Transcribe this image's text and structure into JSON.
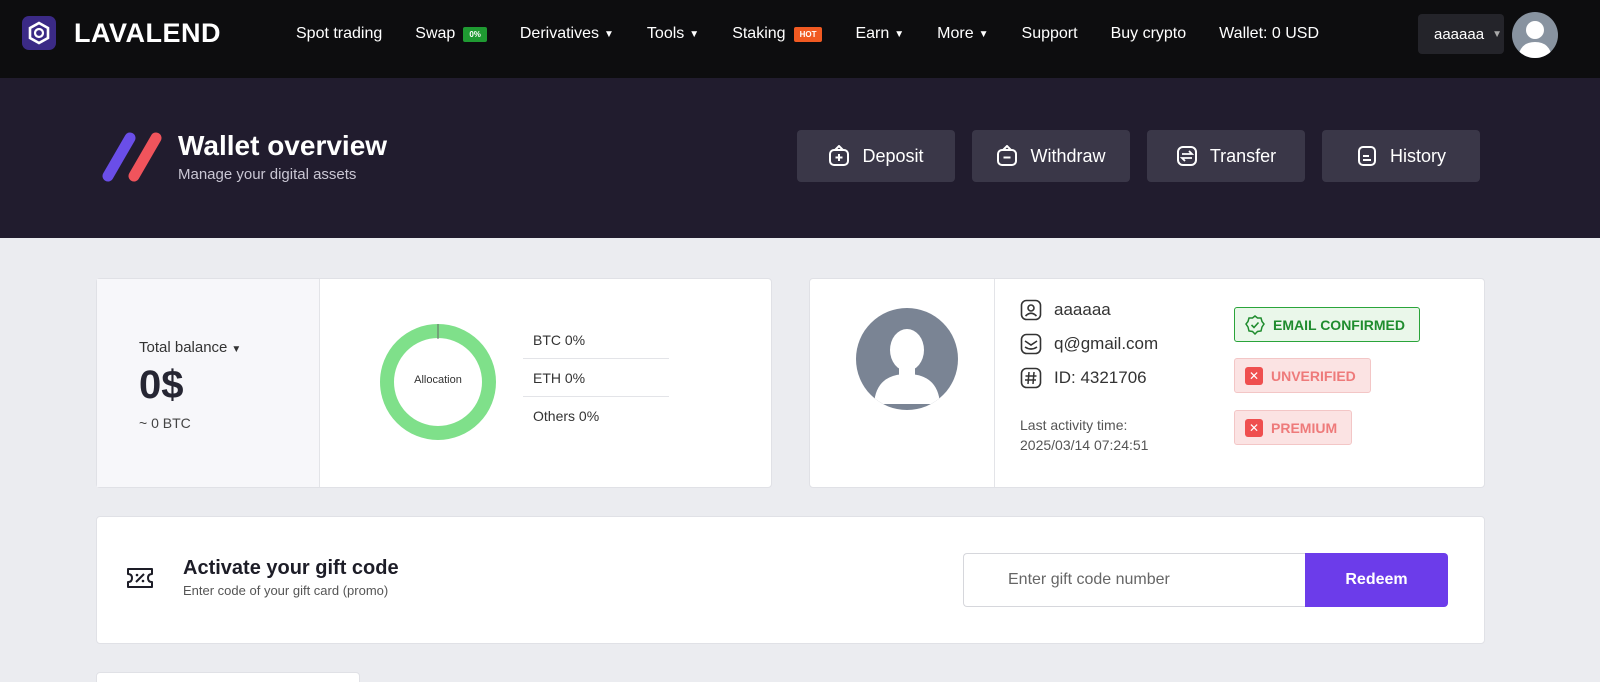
{
  "brand": {
    "name": "LAVALEND",
    "logo_icon": "hexagon-logo-icon"
  },
  "nav": {
    "items": [
      {
        "label": "Spot trading"
      },
      {
        "label": "Swap",
        "badge": "0%",
        "badge_color": "#1f9a32"
      },
      {
        "label": "Derivatives",
        "dropdown": true
      },
      {
        "label": "Tools",
        "dropdown": true
      },
      {
        "label": "Staking",
        "badge": "HOT",
        "badge_color": "#f15a22"
      },
      {
        "label": "Earn",
        "dropdown": true
      },
      {
        "label": "More",
        "dropdown": true
      },
      {
        "label": "Support"
      },
      {
        "label": "Buy crypto"
      },
      {
        "label": "Wallet: 0 USD"
      }
    ],
    "username": "aaaaaa"
  },
  "hero": {
    "title": "Wallet overview",
    "subtitle": "Manage your digital assets",
    "buttons": [
      {
        "label": "Deposit",
        "icon": "wallet-plus-icon"
      },
      {
        "label": "Withdraw",
        "icon": "wallet-minus-icon"
      },
      {
        "label": "Transfer",
        "icon": "transfer-icon"
      },
      {
        "label": "History",
        "icon": "document-icon"
      }
    ]
  },
  "balance": {
    "label": "Total balance",
    "value": "0$",
    "btc": "~ 0 BTC",
    "allocation_label": "Allocation",
    "allocation": [
      {
        "label": "BTC 0%",
        "percent": 0
      },
      {
        "label": "ETH 0%",
        "percent": 0
      },
      {
        "label": "Others 0%",
        "percent": 0
      }
    ],
    "donut_color": "#7fe08a"
  },
  "profile": {
    "username": "aaaaaa",
    "email": "q@gmail.com",
    "id": "ID: 4321706",
    "activity_label": "Last activity time:",
    "activity_time": "2025/03/14 07:24:51",
    "statuses": [
      {
        "label": "EMAIL CONFIRMED",
        "ok": true
      },
      {
        "label": "UNVERIFIED",
        "ok": false
      },
      {
        "label": "PREMIUM",
        "ok": false
      }
    ]
  },
  "gift": {
    "title": "Activate your gift code",
    "subtitle": "Enter code of your gift card (promo)",
    "placeholder": "Enter gift code number",
    "button": "Redeem"
  },
  "colors": {
    "accent": "#6c3cea",
    "hero_bg": "#211c2e",
    "nav_bg": "#0d0d0f"
  }
}
